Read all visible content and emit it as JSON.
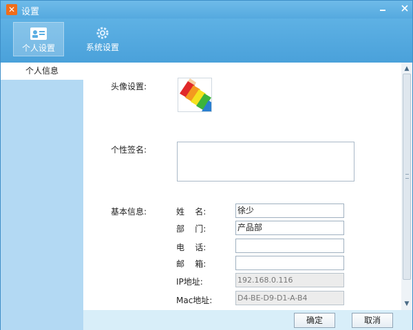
{
  "window": {
    "title": "设置",
    "icon": "app-logo-icon"
  },
  "toolbar": {
    "personal_label": "个人设置",
    "system_label": "系统设置"
  },
  "sidenav": {
    "items": [
      {
        "label": "个人信息"
      }
    ]
  },
  "content": {
    "avatar_label": "头像设置:",
    "signature_label": "个性签名:",
    "signature_value": "",
    "basic_label": "基本信息:",
    "fields": [
      {
        "label": "姓    名:",
        "value": "徐少"
      },
      {
        "label": "部    门:",
        "value": "产品部"
      },
      {
        "label": "电    话:",
        "value": ""
      },
      {
        "label": "邮    箱:",
        "value": ""
      },
      {
        "label": "IP地址:",
        "value": "192.168.0.116"
      },
      {
        "label": "Mac地址:",
        "value": "D4-BE-D9-D1-A-B4"
      }
    ]
  },
  "footer": {
    "ok_label": "确定",
    "cancel_label": "取消"
  },
  "colors": {
    "titlebar": "#5aaee2",
    "sidenav": "#b3d9f3",
    "accent": "#f06d1a"
  }
}
